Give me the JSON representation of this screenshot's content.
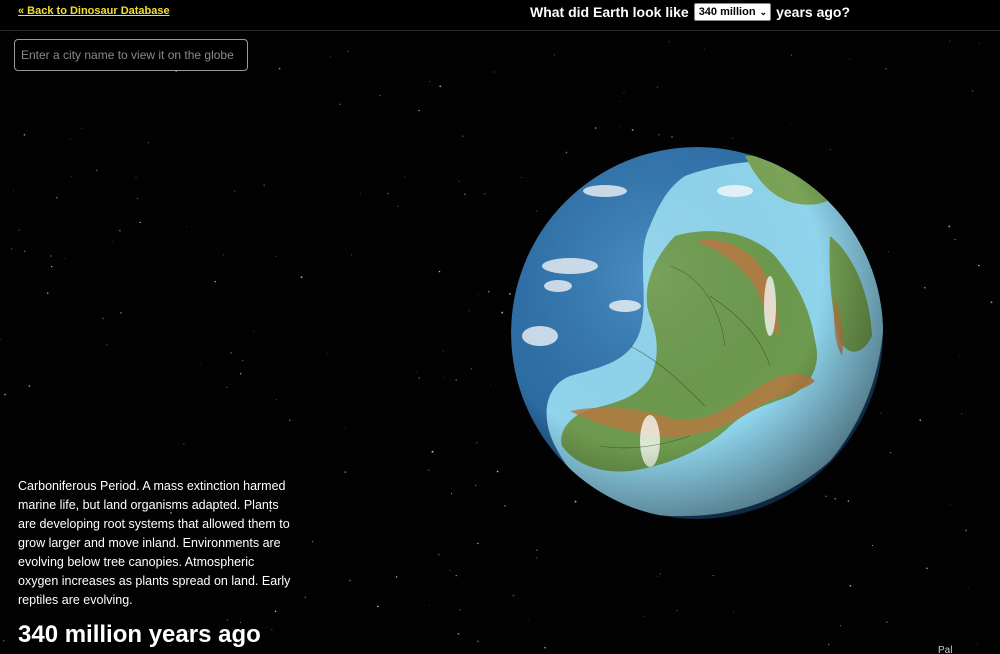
{
  "header": {
    "back_link": "« Back to Dinosaur Database",
    "question_prefix": "What did Earth look like",
    "question_suffix": "years ago?",
    "selected_era": "340 million"
  },
  "search": {
    "placeholder": "Enter a city name to view it on the globe",
    "value": ""
  },
  "info": {
    "description": "Carboniferous Period. A mass extinction harmed marine life, but land organisms adapted. Plants are developing root systems that allowed them to grow larger and move inland. Environments are evolving below tree canopies. Atmospheric oxygen increases as plants spread on land. Early reptiles are evolving.",
    "years_label": "340 million years ago"
  },
  "corner_text": "Pal",
  "colors": {
    "background": "#000000",
    "link": "#f0e030",
    "ocean_deep": "#2c6aa0",
    "ocean_shallow": "#8fd4ec",
    "land": "#6d9a4e",
    "mountains": "#b57a42"
  }
}
